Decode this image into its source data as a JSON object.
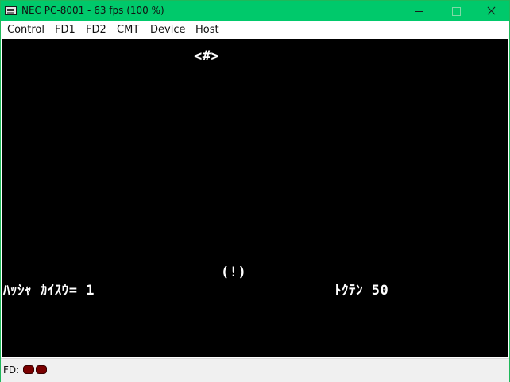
{
  "window": {
    "title": "NEC PC-8001 - 63 fps (100 %)",
    "accent_color": "#00c96b"
  },
  "menu": {
    "items": [
      "Control",
      "FD1",
      "FD2",
      "CMT",
      "Device",
      "Host"
    ]
  },
  "screen": {
    "background": "#000000",
    "text_color": "#ffffff",
    "lines": {
      "top": "<#>",
      "marker": "(!)",
      "attempts": "ﾊｯｼｬ ｶｲｽｳ= 1",
      "score": "ﾄｸﾃﾝ 50"
    }
  },
  "status": {
    "fd_label": "FD:",
    "fd_drives": [
      {
        "name": "FD1",
        "color": "#7a0000"
      },
      {
        "name": "FD2",
        "color": "#7a0000"
      }
    ]
  }
}
